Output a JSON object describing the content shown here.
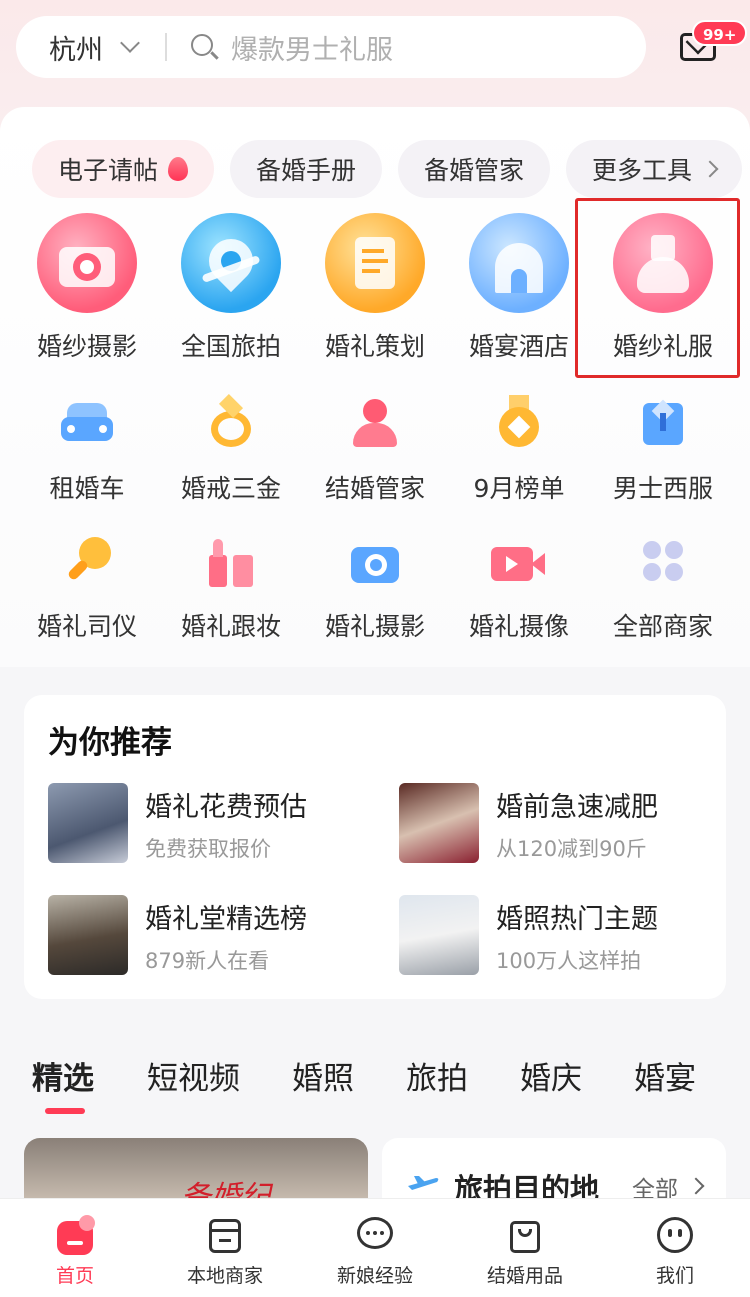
{
  "header": {
    "city": "杭州",
    "search_placeholder": "爆款男士礼服",
    "mail_badge": "99+"
  },
  "chips": [
    {
      "label": "电子请帖"
    },
    {
      "label": "备婚手册"
    },
    {
      "label": "备婚管家"
    },
    {
      "label": "更多工具"
    }
  ],
  "top_categories": [
    {
      "label": "婚纱摄影",
      "icon": "camera-icon",
      "color": "#ff5d7a"
    },
    {
      "label": "全国旅拍",
      "icon": "airplane-location-icon",
      "color": "#2ba5f0"
    },
    {
      "label": "婚礼策划",
      "icon": "planning-document-icon",
      "color": "#ffa929"
    },
    {
      "label": "婚宴酒店",
      "icon": "chapel-icon",
      "color": "#6db0ff"
    },
    {
      "label": "婚纱礼服",
      "icon": "wedding-dress-icon",
      "color": "#ff6c8e"
    }
  ],
  "row2": [
    {
      "label": "租婚车",
      "icon": "car-icon"
    },
    {
      "label": "婚戒三金",
      "icon": "ring-icon"
    },
    {
      "label": "结婚管家",
      "icon": "butler-icon"
    },
    {
      "label": "9月榜单",
      "icon": "medal-icon"
    },
    {
      "label": "男士西服",
      "icon": "suit-icon"
    }
  ],
  "row3": [
    {
      "label": "婚礼司仪",
      "icon": "microphone-icon"
    },
    {
      "label": "婚礼跟妆",
      "icon": "lipstick-icon"
    },
    {
      "label": "婚礼摄影",
      "icon": "camera-icon"
    },
    {
      "label": "婚礼摄像",
      "icon": "video-camera-icon"
    },
    {
      "label": "全部商家",
      "icon": "grid-icon"
    }
  ],
  "recommend": {
    "title": "为你推荐",
    "items": [
      {
        "title": "婚礼花费预估",
        "subtitle": "免费获取报价"
      },
      {
        "title": "婚前急速减肥",
        "subtitle": "从120减到90斤"
      },
      {
        "title": "婚礼堂精选榜",
        "subtitle": "879新人在看"
      },
      {
        "title": "婚照热门主题",
        "subtitle": "100万人这样拍"
      }
    ]
  },
  "tabs": [
    "精选",
    "短视频",
    "婚照",
    "旅拍",
    "婚庆",
    "婚宴"
  ],
  "cards": {
    "left_sign": "备婚纪",
    "right_title": "旅拍目的地",
    "right_more": "全部"
  },
  "bottom_nav": [
    {
      "label": "首页",
      "icon": "home-icon"
    },
    {
      "label": "本地商家",
      "icon": "store-icon"
    },
    {
      "label": "新娘经验",
      "icon": "chat-bubble-icon"
    },
    {
      "label": "结婚用品",
      "icon": "shopping-bag-icon"
    },
    {
      "label": "我们",
      "icon": "smiley-icon"
    }
  ],
  "colors": {
    "accent": "#ff3b55",
    "highlight_border": "#e02a2a"
  }
}
